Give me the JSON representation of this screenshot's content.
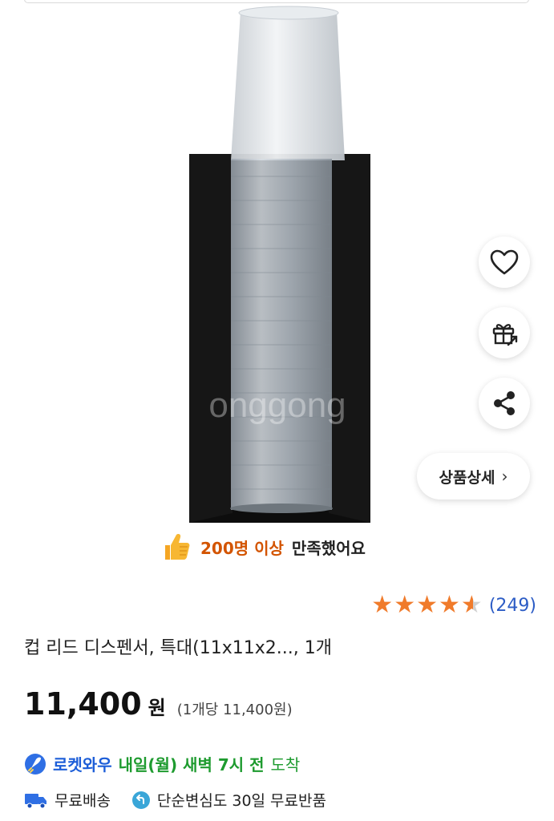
{
  "image_overlay": {
    "watermark": "onggong"
  },
  "actions": {
    "like_icon": "heart-icon",
    "gift_icon": "gift-icon",
    "share_icon": "share-icon",
    "detail_label": "상품상세",
    "detail_chevron": "›"
  },
  "satisfaction": {
    "icon": "thumbs-up-icon",
    "highlight": "200명 이상",
    "rest": "만족했어요"
  },
  "rating": {
    "value": 4.5,
    "max": 5,
    "count": "(249)"
  },
  "product": {
    "title": "컵 리드 디스펜서, 특대(11x11x2..., 1개",
    "price": "11,400",
    "currency": "원",
    "unit_price": "(1개당 11,400원)"
  },
  "delivery": {
    "badge": "로켓와우",
    "arrival_bold": "내일(월) 새벽 7시 전",
    "arrival_plain": "도착"
  },
  "shipping": {
    "free_shipping": "무료배송",
    "returns": "단순변심도 30일 무료반품"
  },
  "colors": {
    "accent_orange": "#d35400",
    "star": "#f07b2b",
    "link_blue": "#2c5cc5",
    "rocket_blue": "#1d5ed8",
    "arrival_green": "#1e9b2f"
  }
}
